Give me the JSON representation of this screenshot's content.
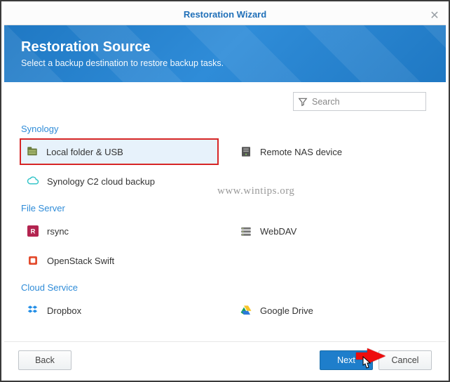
{
  "titlebar": {
    "title": "Restoration Wizard"
  },
  "banner": {
    "heading": "Restoration Source",
    "subheading": "Select a backup destination to restore backup tasks."
  },
  "search": {
    "placeholder": "Search"
  },
  "sections": {
    "synology": {
      "title": "Synology",
      "local_folder": "Local folder & USB",
      "remote_nas": "Remote NAS device",
      "c2_cloud": "Synology C2 cloud backup"
    },
    "file_server": {
      "title": "File Server",
      "rsync": "rsync",
      "webdav": "WebDAV",
      "openstack": "OpenStack Swift"
    },
    "cloud_service": {
      "title": "Cloud Service",
      "dropbox": "Dropbox",
      "google_drive": "Google Drive"
    }
  },
  "footer": {
    "back": "Back",
    "next": "Next",
    "cancel": "Cancel"
  },
  "watermark": "www.wintips.org"
}
